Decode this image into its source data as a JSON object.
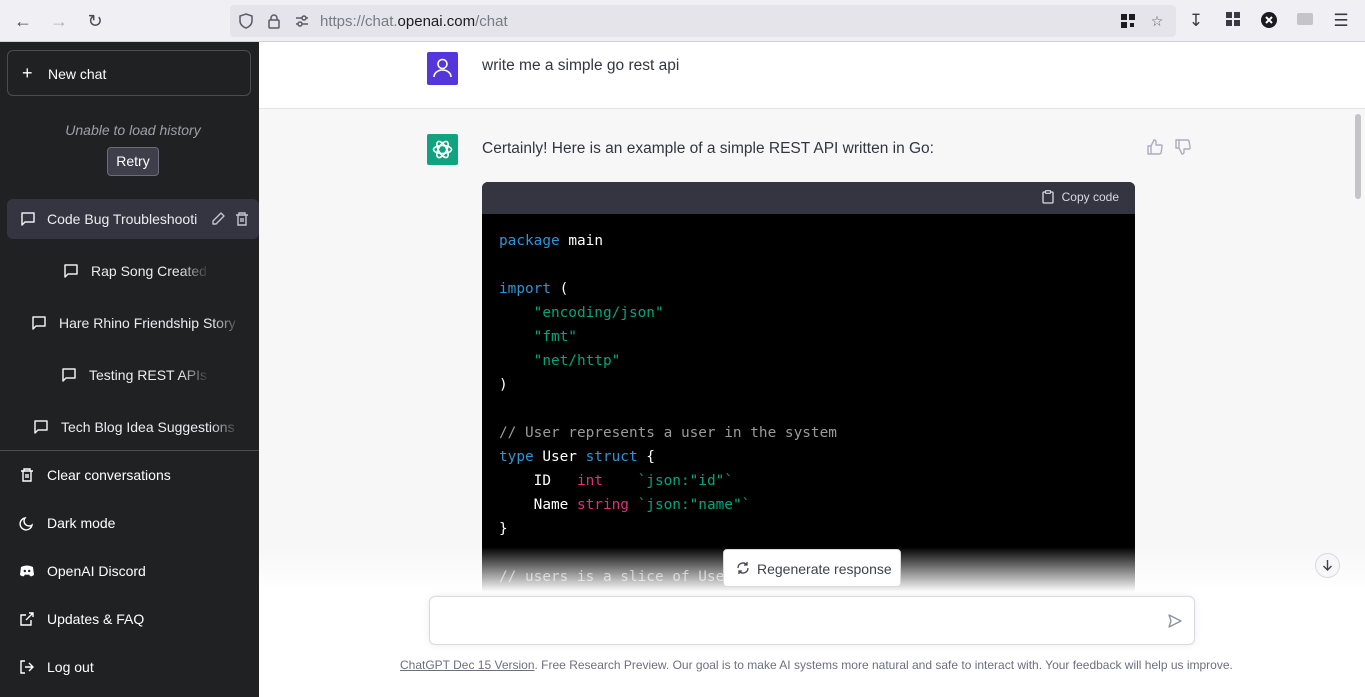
{
  "browser": {
    "url_prefix": "https://chat.",
    "url_domain": "openai.com",
    "url_path": "/chat"
  },
  "sidebar": {
    "new_chat_label": "New chat",
    "history_error": "Unable to load history",
    "retry_label": "Retry",
    "conversations": [
      {
        "title": "Code Bug Troubleshooti",
        "active": true
      },
      {
        "title": "Rap Song Created",
        "active": false
      },
      {
        "title": "Hare Rhino Friendship Story",
        "active": false
      },
      {
        "title": "Testing REST APIs",
        "active": false
      },
      {
        "title": "Tech Blog Idea Suggestions",
        "active": false
      }
    ],
    "menu": [
      {
        "label": "Clear conversations",
        "icon": "trash-icon"
      },
      {
        "label": "Dark mode",
        "icon": "moon-icon"
      },
      {
        "label": "OpenAI Discord",
        "icon": "discord-icon"
      },
      {
        "label": "Updates & FAQ",
        "icon": "external-link-icon"
      },
      {
        "label": "Log out",
        "icon": "logout-icon"
      }
    ]
  },
  "chat": {
    "user_message": "write me a simple go rest api",
    "assistant_intro": "Certainly! Here is an example of a simple REST API written in Go:",
    "copy_code_label": "Copy code",
    "code_lines": [
      "package main",
      "",
      "import (",
      "    \"encoding/json\"",
      "    \"fmt\"",
      "    \"net/http\"",
      ")",
      "",
      "// User represents a user in the system",
      "type User struct {",
      "    ID   int    `json:\"id\"`",
      "    Name string `json:\"name\"`",
      "}",
      "",
      "// users is a slice of Users"
    ],
    "regenerate_label": "Regenerate response",
    "composer_placeholder": ""
  },
  "footer": {
    "version_link": "ChatGPT Dec 15 Version",
    "text": ". Free Research Preview. Our goal is to make AI systems more natural and safe to interact with. Your feedback will help us improve."
  },
  "colors": {
    "sidebar_bg": "#202123",
    "user_avatar": "#5436da",
    "bot_avatar": "#10a37f",
    "code_bg": "#000000",
    "keyword": "#2e95d3",
    "string": "#00a67d",
    "type": "#df3079"
  }
}
